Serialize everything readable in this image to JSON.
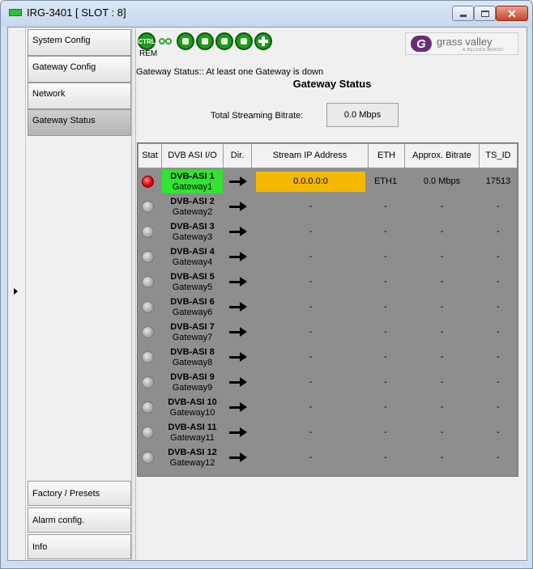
{
  "window": {
    "title": "IRG-3401 [ SLOT : 8]",
    "close_glyph": "✕"
  },
  "nav": {
    "top_items": [
      {
        "label": "System Config"
      },
      {
        "label": "Gateway Config"
      },
      {
        "label": "Network"
      },
      {
        "label": "Gateway Status"
      }
    ],
    "bottom_items": [
      {
        "label": "Factory / Presets"
      },
      {
        "label": "Alarm config."
      },
      {
        "label": "Info"
      }
    ],
    "active": "Gateway Status"
  },
  "toolbar": {
    "ctrl_label": "CTRL",
    "rem_label": "REM",
    "icons": [
      "ctrl-icon",
      "link-icon",
      "status-icon",
      "status-icon",
      "gateway-icon",
      "gateway-icon",
      "plus-icon"
    ]
  },
  "logo": {
    "mark": "G",
    "name": "grass valley",
    "sub": "A BELDEN BRAND"
  },
  "gateway_status": {
    "message": "Gateway Status:: At least one Gateway is down",
    "title": "Gateway Status",
    "total_bitrate_label": "Total Streaming Bitrate:",
    "total_bitrate_value": "0.0 Mbps"
  },
  "table": {
    "headers": [
      "Stat",
      "DVB ASI I/O",
      "Dir.",
      "Stream IP Address",
      "ETH",
      "Approx. Bitrate",
      "TS_ID"
    ],
    "rows": [
      {
        "status": "red",
        "asi": "DVB-ASI 1",
        "gateway": "Gateway1",
        "active": true,
        "ip": "0.0.0.0:0",
        "eth": "ETH1",
        "bitrate": "0.0 Mbps",
        "ts_id": "17513"
      },
      {
        "status": "gray",
        "asi": "DVB-ASI 2",
        "gateway": "Gateway2",
        "active": false,
        "ip": "-",
        "eth": "-",
        "bitrate": "-",
        "ts_id": "-"
      },
      {
        "status": "gray",
        "asi": "DVB-ASI 3",
        "gateway": "Gateway3",
        "active": false,
        "ip": "-",
        "eth": "-",
        "bitrate": "-",
        "ts_id": "-"
      },
      {
        "status": "gray",
        "asi": "DVB-ASI 4",
        "gateway": "Gateway4",
        "active": false,
        "ip": "-",
        "eth": "-",
        "bitrate": "-",
        "ts_id": "-"
      },
      {
        "status": "gray",
        "asi": "DVB-ASI 5",
        "gateway": "Gateway5",
        "active": false,
        "ip": "-",
        "eth": "-",
        "bitrate": "-",
        "ts_id": "-"
      },
      {
        "status": "gray",
        "asi": "DVB-ASI 6",
        "gateway": "Gateway6",
        "active": false,
        "ip": "-",
        "eth": "-",
        "bitrate": "-",
        "ts_id": "-"
      },
      {
        "status": "gray",
        "asi": "DVB-ASI 7",
        "gateway": "Gateway7",
        "active": false,
        "ip": "-",
        "eth": "-",
        "bitrate": "-",
        "ts_id": "-"
      },
      {
        "status": "gray",
        "asi": "DVB-ASI 8",
        "gateway": "Gateway8",
        "active": false,
        "ip": "-",
        "eth": "-",
        "bitrate": "-",
        "ts_id": "-"
      },
      {
        "status": "gray",
        "asi": "DVB-ASI 9",
        "gateway": "Gateway9",
        "active": false,
        "ip": "-",
        "eth": "-",
        "bitrate": "-",
        "ts_id": "-"
      },
      {
        "status": "gray",
        "asi": "DVB-ASI 10",
        "gateway": "Gateway10",
        "active": false,
        "ip": "-",
        "eth": "-",
        "bitrate": "-",
        "ts_id": "-"
      },
      {
        "status": "gray",
        "asi": "DVB-ASI 11",
        "gateway": "Gateway11",
        "active": false,
        "ip": "-",
        "eth": "-",
        "bitrate": "-",
        "ts_id": "-"
      },
      {
        "status": "gray",
        "asi": "DVB-ASI 12",
        "gateway": "Gateway12",
        "active": false,
        "ip": "-",
        "eth": "-",
        "bitrate": "-",
        "ts_id": "-"
      }
    ]
  },
  "colors": {
    "active_asi": "#2fe52f",
    "active_ip": "#f5b800",
    "status_red": "#e00000",
    "status_gray": "#a8a8a8",
    "grid_bg": "#8e8e8e"
  }
}
